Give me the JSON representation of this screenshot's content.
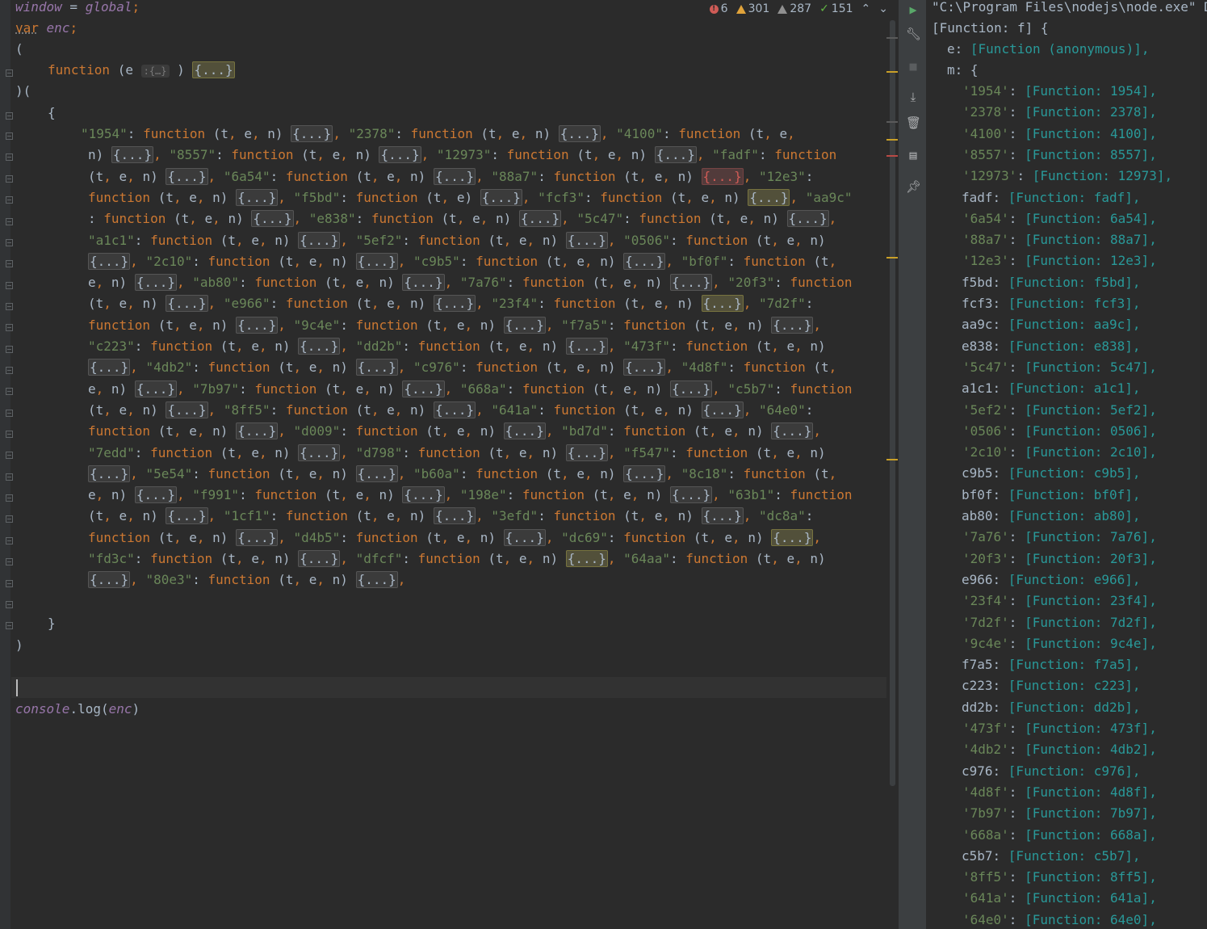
{
  "editor": {
    "line1": {
      "global_ref": "window",
      "op": " = ",
      "value": "global",
      "end": ";"
    },
    "line2": {
      "keyword": "var",
      "name": "enc",
      "end": ";"
    },
    "paren_open": "(",
    "iife_fn": {
      "keyword": "function",
      "param": "e",
      "hint": ":{…}",
      "close": ")",
      "body": "{...}"
    },
    "iife_call": ")(",
    "brace_open": "{",
    "modules": [
      "1954",
      "2378",
      "4100",
      "8557",
      "12973",
      "fadf",
      "6a54",
      "88a7",
      "12e3",
      "f5bd",
      "fcf3",
      "aa9c",
      "e838",
      "5c47",
      "a1c1",
      "5ef2",
      "0506",
      "2c10",
      "c9b5",
      "bf0f",
      "ab80",
      "7a76",
      "20f3",
      "e966",
      "23f4",
      "7d2f",
      "9c4e",
      "f7a5",
      "c223",
      "dd2b",
      "473f",
      "4db2",
      "c976",
      "4d8f",
      "7b97",
      "668a",
      "c5b7",
      "8ff5",
      "641a",
      "64e0",
      "d009",
      "bd7d",
      "7edd",
      "d798",
      "f547",
      "5e54",
      "b60a",
      "8c18",
      "f991",
      "198e",
      "63b1",
      "1cf1",
      "3efd",
      "dc8a",
      "d4b5",
      "dc69",
      "fd3c",
      "dfcf",
      "64aa",
      "80e3"
    ],
    "fn_keyword": "function",
    "params_full": "(t, e, n)",
    "params_f5bd": "(t, e)",
    "fold_placeholder": "{...}",
    "brace_close": "}",
    "paren_close": ")",
    "console_line": {
      "obj": "console",
      "method": "log",
      "arg": "enc"
    }
  },
  "inspections": {
    "errors": "6",
    "warnings": "301",
    "weak_warnings": "287",
    "ok": "151"
  },
  "run_console": {
    "header": "\"C:\\Program Files\\nodejs\\node.exe\" D",
    "root": "[Function: f] {",
    "e_key": "e:",
    "e_val": "[Function (anonymous)],",
    "m_key": "m: {",
    "entries": [
      {
        "key": "'1954'",
        "quoted": true,
        "val": "[Function: 1954],"
      },
      {
        "key": "'2378'",
        "quoted": true,
        "val": "[Function: 2378],"
      },
      {
        "key": "'4100'",
        "quoted": true,
        "val": "[Function: 4100],"
      },
      {
        "key": "'8557'",
        "quoted": true,
        "val": "[Function: 8557],"
      },
      {
        "key": "'12973'",
        "quoted": true,
        "val": "[Function: 12973],"
      },
      {
        "key": "fadf",
        "quoted": false,
        "val": "[Function: fadf],"
      },
      {
        "key": "'6a54'",
        "quoted": true,
        "val": "[Function: 6a54],"
      },
      {
        "key": "'88a7'",
        "quoted": true,
        "val": "[Function: 88a7],"
      },
      {
        "key": "'12e3'",
        "quoted": true,
        "val": "[Function: 12e3],"
      },
      {
        "key": "f5bd",
        "quoted": false,
        "val": "[Function: f5bd],"
      },
      {
        "key": "fcf3",
        "quoted": false,
        "val": "[Function: fcf3],"
      },
      {
        "key": "aa9c",
        "quoted": false,
        "val": "[Function: aa9c],"
      },
      {
        "key": "e838",
        "quoted": false,
        "val": "[Function: e838],"
      },
      {
        "key": "'5c47'",
        "quoted": true,
        "val": "[Function: 5c47],"
      },
      {
        "key": "a1c1",
        "quoted": false,
        "val": "[Function: a1c1],"
      },
      {
        "key": "'5ef2'",
        "quoted": true,
        "val": "[Function: 5ef2],"
      },
      {
        "key": "'0506'",
        "quoted": true,
        "val": "[Function: 0506],"
      },
      {
        "key": "'2c10'",
        "quoted": true,
        "val": "[Function: 2c10],"
      },
      {
        "key": "c9b5",
        "quoted": false,
        "val": "[Function: c9b5],"
      },
      {
        "key": "bf0f",
        "quoted": false,
        "val": "[Function: bf0f],"
      },
      {
        "key": "ab80",
        "quoted": false,
        "val": "[Function: ab80],"
      },
      {
        "key": "'7a76'",
        "quoted": true,
        "val": "[Function: 7a76],"
      },
      {
        "key": "'20f3'",
        "quoted": true,
        "val": "[Function: 20f3],"
      },
      {
        "key": "e966",
        "quoted": false,
        "val": "[Function: e966],"
      },
      {
        "key": "'23f4'",
        "quoted": true,
        "val": "[Function: 23f4],"
      },
      {
        "key": "'7d2f'",
        "quoted": true,
        "val": "[Function: 7d2f],"
      },
      {
        "key": "'9c4e'",
        "quoted": true,
        "val": "[Function: 9c4e],"
      },
      {
        "key": "f7a5",
        "quoted": false,
        "val": "[Function: f7a5],"
      },
      {
        "key": "c223",
        "quoted": false,
        "val": "[Function: c223],"
      },
      {
        "key": "dd2b",
        "quoted": false,
        "val": "[Function: dd2b],"
      },
      {
        "key": "'473f'",
        "quoted": true,
        "val": "[Function: 473f],"
      },
      {
        "key": "'4db2'",
        "quoted": true,
        "val": "[Function: 4db2],"
      },
      {
        "key": "c976",
        "quoted": false,
        "val": "[Function: c976],"
      },
      {
        "key": "'4d8f'",
        "quoted": true,
        "val": "[Function: 4d8f],"
      },
      {
        "key": "'7b97'",
        "quoted": true,
        "val": "[Function: 7b97],"
      },
      {
        "key": "'668a'",
        "quoted": true,
        "val": "[Function: 668a],"
      },
      {
        "key": "c5b7",
        "quoted": false,
        "val": "[Function: c5b7],"
      },
      {
        "key": "'8ff5'",
        "quoted": true,
        "val": "[Function: 8ff5],"
      },
      {
        "key": "'641a'",
        "quoted": true,
        "val": "[Function: 641a],"
      },
      {
        "key": "'64e0'",
        "quoted": true,
        "val": "[Function: 64e0],"
      }
    ]
  },
  "tools": [
    "run-icon",
    "wrench-icon",
    "stop-icon",
    "scroll-to-end-icon",
    "trash-icon",
    "layout-icon",
    "pin-icon"
  ]
}
